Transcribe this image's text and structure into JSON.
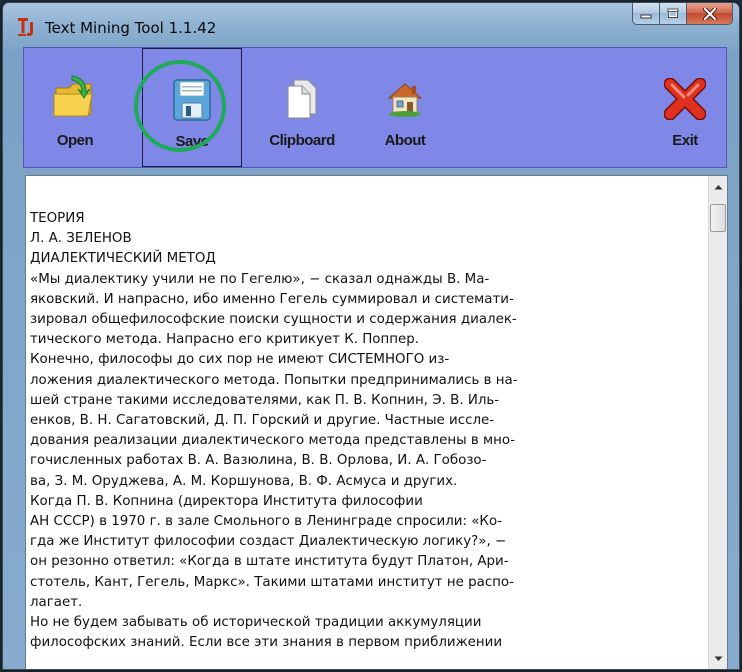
{
  "window": {
    "title": "Text Mining Tool 1.1.42",
    "app_icon": "tj-logo-icon"
  },
  "caption": {
    "minimize_icon": "minimize-icon",
    "maximize_icon": "maximize-icon",
    "close_icon": "close-icon"
  },
  "toolbar": {
    "open_label": "Open",
    "save_label": "Save",
    "clipboard_label": "Clipboard",
    "about_label": "About",
    "exit_label": "Exit",
    "background_color": "#7f88e6",
    "highlight_color": "#1faa5a"
  },
  "document": {
    "lines": [
      "ТЕОРИЯ",
      "Л. А. ЗЕЛЕНОВ",
      "ДИАЛЕКТИЧЕСКИЙ МЕТОД",
      "«Мы диалектику учили не по Гегелю», − сказал однажды В. Ма-",
      "яковский. И напрасно, ибо именно Гегель суммировал и системати-",
      "зировал общефилософские поиски сущности и содержания диалек-",
      "тического метода. Напрасно его критикует К. Поппер.",
      "Конечно, философы до сих пор не имеют СИСТЕМНОГО из-",
      "ложения диалектического метода. Попытки предпринимались в на-",
      "шей стране такими исследователями, как П. В. Копнин, Э. В. Иль-",
      "енков, В. Н. Сагатовский, Д. П. Горский и другие. Частные иссле-",
      "дования реализации диалектического метода представлены в мно-",
      "гочисленных работах В. А. Вазюлина, В. В. Орлова, И. А. Гобозо-",
      "ва, З. М. Оруджева, А. М. Коршунова, В. Ф. Асмуса и других.",
      "Когда П. В. Копнина (директора Института философии",
      "АН СССР) в 1970 г. в зале Смольного в Ленинграде спросили: «Ко-",
      "гда же Институт философии создаст Диалектическую логику?», −",
      "он резонно ответил: «Когда в штате института будут Платон, Ари-",
      "стотель, Кант, Гегель, Маркс». Такими штатами институт не распо-",
      "лагает.",
      "Но не будем забывать об исторической традиции аккумуляции",
      "философских знаний. Если все эти знания в первом приближении"
    ]
  },
  "scrollbar": {
    "up_icon": "scroll-up-arrow-icon",
    "down_icon": "scroll-down-arrow-icon"
  }
}
